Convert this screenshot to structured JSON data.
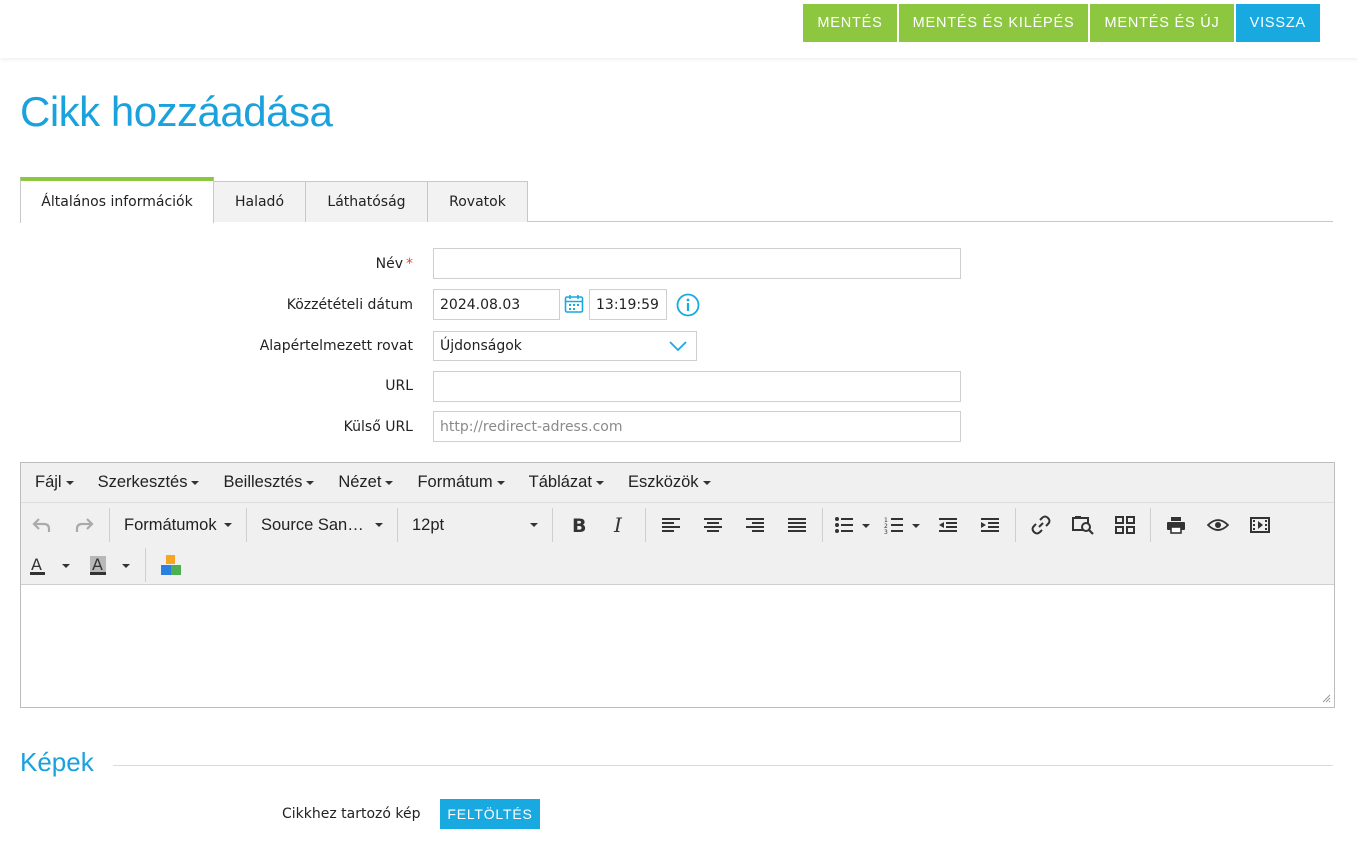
{
  "actions": {
    "save": "MENTÉS",
    "save_exit": "MENTÉS ÉS KILÉPÉS",
    "save_new": "MENTÉS ÉS ÚJ",
    "back": "VISSZA"
  },
  "page_title": "Cikk hozzáadása",
  "tabs": [
    {
      "label": "Általános információk",
      "active": true
    },
    {
      "label": "Haladó",
      "active": false
    },
    {
      "label": "Láthatóság",
      "active": false
    },
    {
      "label": "Rovatok",
      "active": false
    }
  ],
  "form": {
    "name_label": "Név",
    "name_required_mark": "*",
    "name_value": "",
    "date_label": "Közzétételi dátum",
    "date_value": "2024.08.03",
    "time_value": "13:19:59",
    "section_label": "Alapértelmezett rovat",
    "section_value": "Újdonságok",
    "url_label": "URL",
    "url_value": "",
    "ext_url_label": "Külső URL",
    "ext_url_placeholder": "http://redirect-adress.com"
  },
  "editor": {
    "menu": [
      "Fájl",
      "Szerkesztés",
      "Beillesztés",
      "Nézet",
      "Formátum",
      "Táblázat",
      "Eszközök"
    ],
    "formats_label": "Formátumok",
    "font_label": "Source San…",
    "size_label": "12pt",
    "icons": [
      "undo-icon",
      "redo-icon",
      "bold-icon",
      "italic-icon",
      "align-left-icon",
      "align-center-icon",
      "align-right-icon",
      "align-justify-icon",
      "bullet-list-icon",
      "numbered-list-icon",
      "outdent-icon",
      "indent-icon",
      "link-icon",
      "image-search-icon",
      "grid-icon",
      "print-icon",
      "preview-icon",
      "media-icon",
      "text-color-icon",
      "background-color-icon",
      "blocks-icon"
    ]
  },
  "images": {
    "section_title": "Képek",
    "field_label": "Cikkhez tartozó kép",
    "upload_label": "FELTÖLTÉS"
  },
  "colors": {
    "green": "#8dc63f",
    "blue": "#19a9e1",
    "title_blue": "#1ba1dc"
  }
}
